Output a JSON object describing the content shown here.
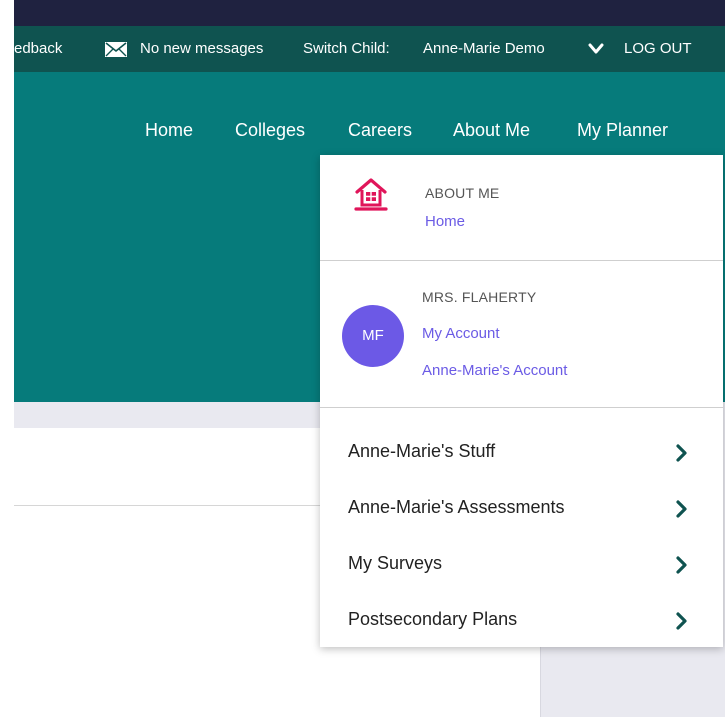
{
  "utility_bar": {
    "feedback": "edback",
    "messages": "No new messages",
    "switch_child_label": "Switch Child:",
    "child_name": "Anne-Marie Demo",
    "logout": "LOG OUT"
  },
  "nav": {
    "items": [
      {
        "label": "Home"
      },
      {
        "label": "Colleges"
      },
      {
        "label": "Careers"
      },
      {
        "label": "About Me"
      },
      {
        "label": "My Planner"
      }
    ]
  },
  "dropdown": {
    "about_section": {
      "heading": "ABOUT ME",
      "link": "Home"
    },
    "account_section": {
      "heading": "MRS. FLAHERTY",
      "avatar_initials": "MF",
      "links": [
        "My Account",
        "Anne-Marie's Account"
      ]
    },
    "items": [
      {
        "label": "Anne-Marie's Stuff"
      },
      {
        "label": "Anne-Marie's Assessments"
      },
      {
        "label": "My Surveys"
      },
      {
        "label": "Postsecondary Plans"
      }
    ]
  },
  "colors": {
    "top_strip": "#1f2240",
    "utility_bar": "#0f5350",
    "main_teal": "#067b7b",
    "accent_link": "#6b5be5",
    "avatar_bg": "#6c59e6",
    "house_pink": "#e0155a",
    "chevron": "#0f5350"
  },
  "icons": {
    "mail": "mail-icon",
    "switch_child": "chevron-down-icon",
    "about_me": "house-icon",
    "menu_item": "chevron-right-icon"
  }
}
